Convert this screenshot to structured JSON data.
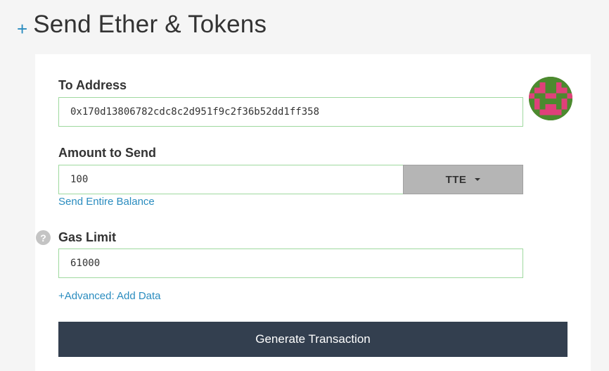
{
  "header": {
    "title": "Send Ether & Tokens"
  },
  "form": {
    "to_address": {
      "label": "To Address",
      "value": "0x170d13806782cdc8c2d951f9c2f36b52dd1ff358"
    },
    "amount": {
      "label": "Amount to Send",
      "value": "100",
      "token": "TTE",
      "send_entire_balance": "Send Entire Balance"
    },
    "gas": {
      "label": "Gas Limit",
      "value": "61000",
      "help_glyph": "?"
    },
    "advanced_link": "+Advanced: Add Data",
    "generate_button": "Generate Transaction"
  },
  "icons": {
    "header": "plus-icon",
    "help": "question-circle-icon",
    "identicon": "address-identicon",
    "dropdown": "caret-down-icon"
  },
  "colors": {
    "accent": "#2a8cbf",
    "valid_border": "#9fd99f",
    "button_dark": "#333f4f",
    "token_button": "#b5b5b5",
    "identicon_green": "#4c8a2f",
    "identicon_pink": "#e0407a"
  }
}
